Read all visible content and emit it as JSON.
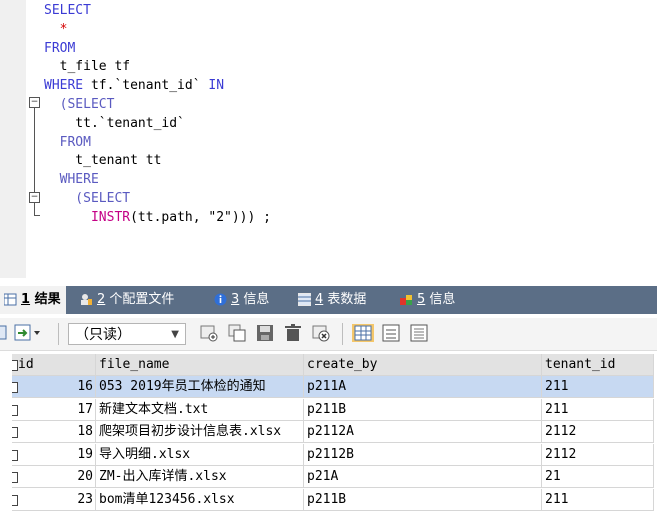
{
  "editor": {
    "lines": [
      {
        "n": "",
        "parts": [
          {
            "t": "SELECT",
            "c": "kw"
          }
        ]
      },
      {
        "n": "",
        "parts": [
          {
            "t": "  ",
            "c": ""
          },
          {
            "t": "*",
            "c": "star"
          }
        ]
      },
      {
        "n": "",
        "parts": [
          {
            "t": "FROM",
            "c": "kw"
          }
        ]
      },
      {
        "n": "",
        "parts": [
          {
            "t": "  t_file tf",
            "c": ""
          }
        ]
      },
      {
        "n": "",
        "parts": [
          {
            "t": "WHERE",
            "c": "kw"
          },
          {
            "t": " tf.`tenant_id` ",
            "c": ""
          },
          {
            "t": "IN",
            "c": "kw"
          }
        ]
      },
      {
        "n": "",
        "parts": [
          {
            "t": "  (SELECT",
            "c": "kw2"
          }
        ]
      },
      {
        "n": "",
        "parts": [
          {
            "t": "    tt.`tenant_id`",
            "c": ""
          }
        ]
      },
      {
        "n": "",
        "parts": [
          {
            "t": "  FROM",
            "c": "kw2"
          }
        ]
      },
      {
        "n": "",
        "parts": [
          {
            "t": "    t_tenant tt",
            "c": ""
          }
        ]
      },
      {
        "n": "",
        "parts": [
          {
            "t": "  WHERE",
            "c": "kw2"
          }
        ]
      },
      {
        "n": "",
        "parts": [
          {
            "t": "    (SELECT",
            "c": "kw2"
          }
        ]
      },
      {
        "n": "",
        "parts": [
          {
            "t": "      ",
            "c": ""
          },
          {
            "t": "INSTR",
            "c": "fn"
          },
          {
            "t": "(tt.path, \"2\"))) ;",
            "c": ""
          }
        ]
      }
    ]
  },
  "tabs": [
    {
      "num": "1",
      "label": "结果",
      "active": true,
      "icon": "grid-icon"
    },
    {
      "num": "2",
      "label": "个配置文件",
      "active": false,
      "icon": "profile-icon"
    },
    {
      "num": "3",
      "label": "信息",
      "active": false,
      "icon": "info-icon"
    },
    {
      "num": "4",
      "label": "表数据",
      "active": false,
      "icon": "table-icon"
    },
    {
      "num": "5",
      "label": "信息",
      "active": false,
      "icon": "info-icon"
    }
  ],
  "toolbar": {
    "readonly_label": "（只读）"
  },
  "grid": {
    "columns": [
      "id",
      "file_name",
      "create_by",
      "tenant_id"
    ],
    "rows": [
      {
        "id": "16",
        "file_name": "053 2019年员工体检的通知",
        "create_by": "p211A",
        "tenant_id": "211",
        "selected": true
      },
      {
        "id": "17",
        "file_name": "新建文本文档.txt",
        "create_by": "p211B",
        "tenant_id": "211",
        "selected": false
      },
      {
        "id": "18",
        "file_name": "爬架项目初步设计信息表.xlsx",
        "create_by": "p2112A",
        "tenant_id": "2112",
        "selected": false
      },
      {
        "id": "19",
        "file_name": "导入明细.xlsx",
        "create_by": "p2112B",
        "tenant_id": "2112",
        "selected": false
      },
      {
        "id": "20",
        "file_name": "ZM-出入库详情.xlsx",
        "create_by": "p21A",
        "tenant_id": "21",
        "selected": false
      },
      {
        "id": "23",
        "file_name": "bom清单123456.xlsx",
        "create_by": "p211B",
        "tenant_id": "211",
        "selected": false
      }
    ]
  },
  "colors": {
    "tab_bar": "#5b6e86",
    "keyword": "#3b3bd4",
    "selected_row": "#c7d9f2"
  }
}
